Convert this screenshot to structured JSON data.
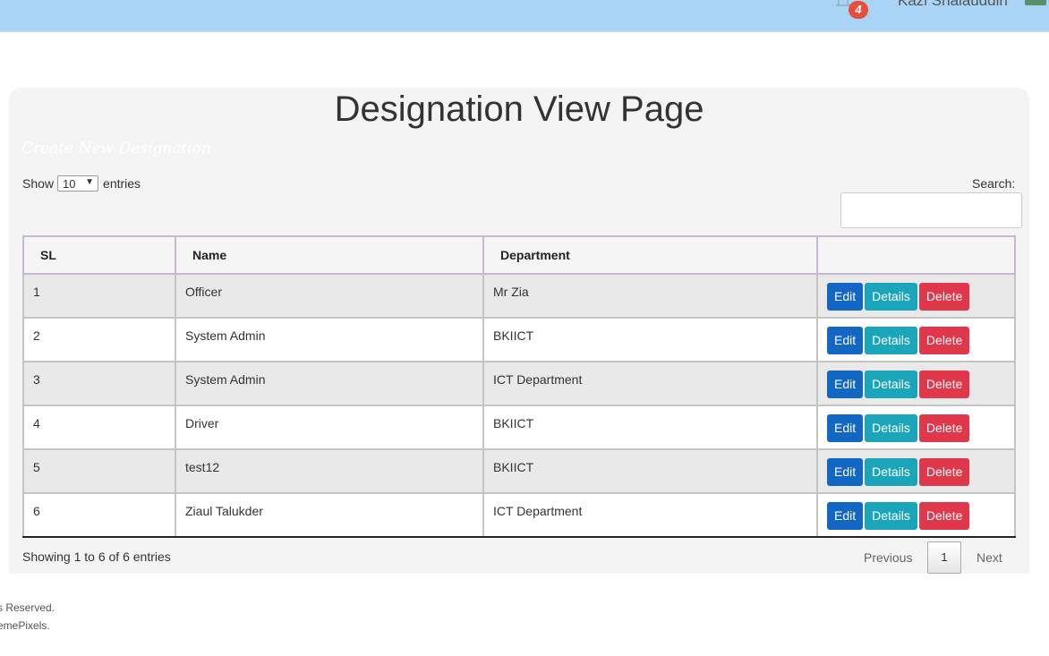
{
  "header": {
    "notification_count": "4",
    "user_name": "Kazi Shalauddin"
  },
  "page": {
    "title": "Designation View Page",
    "create_link": "Create New Designation"
  },
  "table_controls": {
    "show_label": "Show",
    "entries_value": "10",
    "entries_label": "entries",
    "search_label": "Search:",
    "search_value": ""
  },
  "table": {
    "columns": [
      "SL",
      "Name",
      "Department",
      ""
    ],
    "rows": [
      {
        "sl": "1",
        "name": "Officer",
        "department": "Mr Zia"
      },
      {
        "sl": "2",
        "name": "System Admin",
        "department": "BKIICT"
      },
      {
        "sl": "3",
        "name": "System Admin",
        "department": "ICT Department"
      },
      {
        "sl": "4",
        "name": "Driver",
        "department": "BKIICT"
      },
      {
        "sl": "5",
        "name": "test12",
        "department": "BKIICT"
      },
      {
        "sl": "6",
        "name": "Ziaul Talukder",
        "department": "ICT Department"
      }
    ],
    "actions": {
      "edit": "Edit",
      "details": "Details",
      "delete": "Delete"
    }
  },
  "pagination": {
    "info": "Showing 1 to 6 of 6 entries",
    "previous": "Previous",
    "current_page": "1",
    "next": "Next"
  },
  "footer": {
    "line1": "s Reserved.",
    "line2": "emePixels."
  },
  "colors": {
    "topbar": "#aad4f5",
    "edit": "#1266c4",
    "details": "#1ba5bb",
    "delete": "#e0374a",
    "badge": "#e74c3c"
  }
}
